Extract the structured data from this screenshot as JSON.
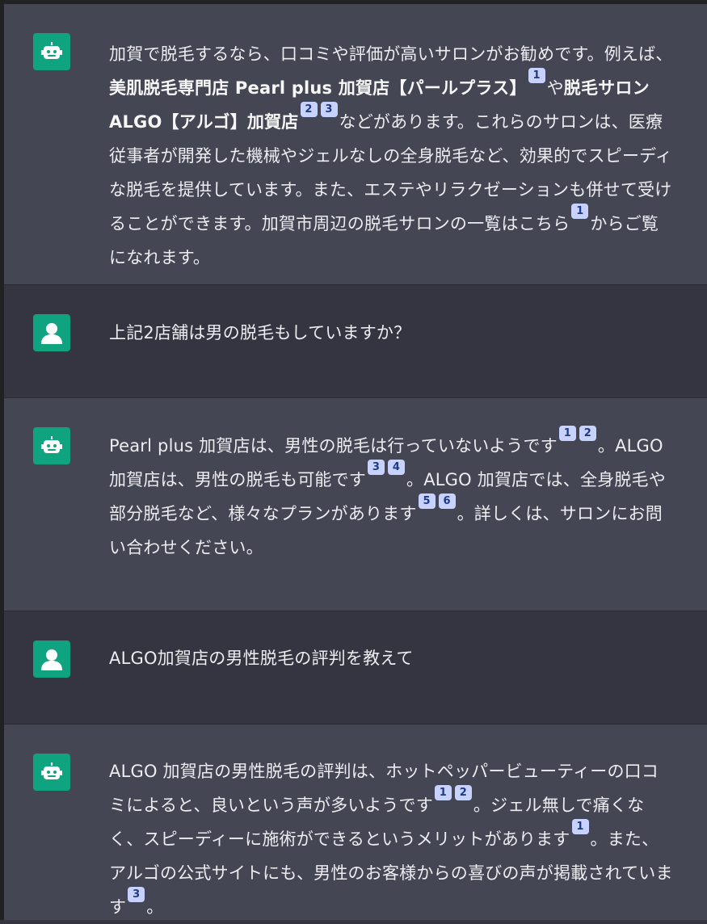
{
  "messages": [
    {
      "role": "assistant",
      "parts": [
        {
          "t": "加賀で脱毛するなら、口コミや評価が高いサロンがお勧めです。例えば、"
        },
        {
          "b": "美肌脱毛専門店 Pearl plus 加賀店【パールプラス】"
        },
        {
          "c": "1"
        },
        {
          "t": "や"
        },
        {
          "b": "脱毛サロン ALGO【アルゴ】加賀店"
        },
        {
          "c": "2"
        },
        {
          "c": "3"
        },
        {
          "t": "などがあります。これらのサロンは、医療従事者が開発した機械やジェルなしの全身脱毛など、効果的でスピーディな脱毛を提供しています。また、エステやリラクゼーションも併せて受けることができます。加賀市周辺の脱毛サロンの一覧はこちら"
        },
        {
          "c": "1"
        },
        {
          "t": "からご覧になれます。"
        }
      ]
    },
    {
      "role": "user",
      "parts": [
        {
          "t": "上記2店舗は男の脱毛もしていますか？"
        }
      ]
    },
    {
      "role": "assistant",
      "parts": [
        {
          "t": "Pearl plus 加賀店は、男性の脱毛は行っていないようです"
        },
        {
          "c": "1"
        },
        {
          "c": "2"
        },
        {
          "t": "。ALGO 加賀店は、男性の脱毛も可能です"
        },
        {
          "c": "3"
        },
        {
          "c": "4"
        },
        {
          "t": "。ALGO 加賀店では、全身脱毛や部分脱毛など、様々なプランがあります"
        },
        {
          "c": "5"
        },
        {
          "c": "6"
        },
        {
          "t": "。詳しくは、サロンにお問い合わせください。"
        }
      ]
    },
    {
      "role": "user",
      "parts": [
        {
          "t": "ALGO加賀店の男性脱毛の評判を教えて"
        }
      ]
    },
    {
      "role": "assistant",
      "parts": [
        {
          "t": "ALGO 加賀店の男性脱毛の評判は、ホットペッパービューティーの口コミによると、良いという声が多いようです"
        },
        {
          "c": "1"
        },
        {
          "c": "2"
        },
        {
          "t": "。ジェル無しで痛くなく、スピーディーに施術ができるというメリットがあります"
        },
        {
          "c": "1"
        },
        {
          "t": "。また、アルゴの公式サイトにも、男性のお客様からの喜びの声が掲載されています"
        },
        {
          "c": "3"
        },
        {
          "t": "。"
        }
      ]
    }
  ],
  "icons": {
    "assistant": "robot-icon",
    "user": "user-icon"
  },
  "colors": {
    "avatar_bg": "#10a37f",
    "assistant_bg": "#444654",
    "user_bg": "#343541",
    "citation_bg": "#c7d2fe"
  }
}
